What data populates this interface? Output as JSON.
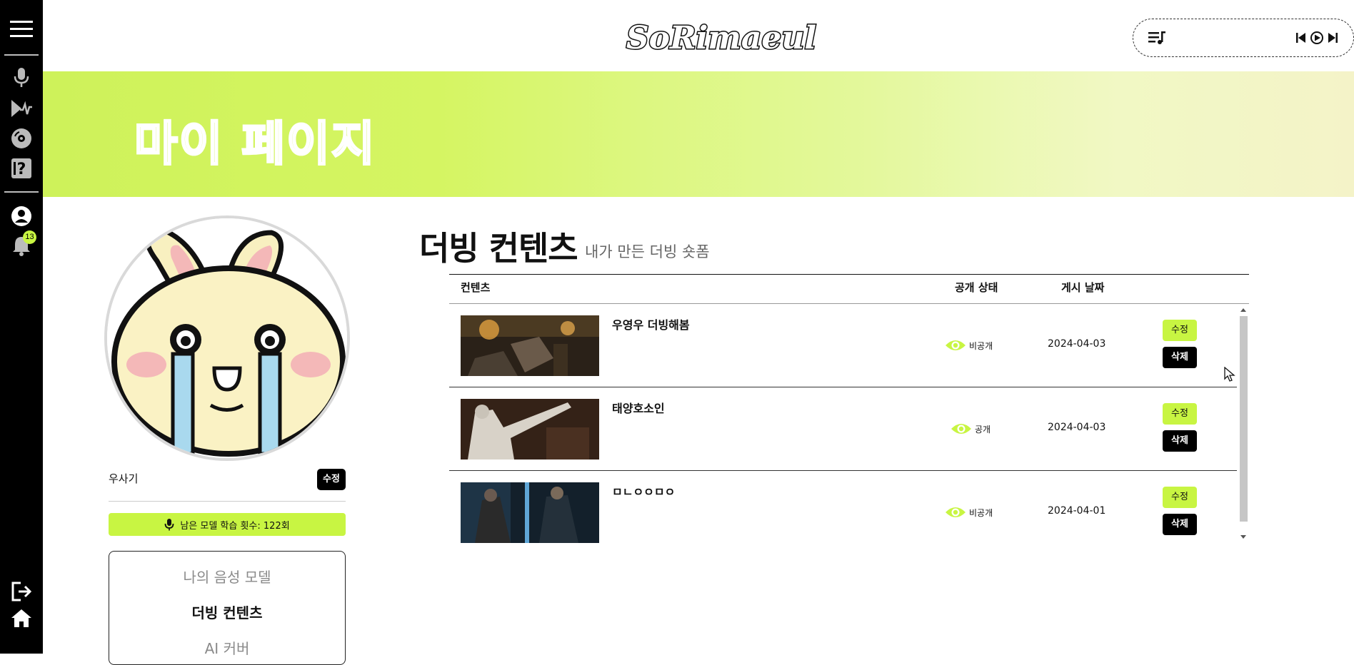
{
  "app": {
    "logo_text": "SoRimaeul"
  },
  "sidebar": {
    "icons": [
      "menu-icon",
      "microphone-icon",
      "voice-wave-icon",
      "disc-icon",
      "help-icon",
      "user-icon",
      "bell-icon",
      "logout-icon",
      "home-icon"
    ],
    "notification_count": "13"
  },
  "banner": {
    "title": "마이 페이지"
  },
  "profile": {
    "username": "우사기",
    "edit_label": "수정",
    "training_text": "남은 모델 학습 횟수: 122회",
    "menu": [
      "나의 음성 모델",
      "더빙 컨텐츠",
      "AI 커버"
    ]
  },
  "section": {
    "title": "더빙 컨텐츠",
    "subtitle": "내가 만든 더빙 숏폼"
  },
  "table": {
    "headers": {
      "content": "컨텐츠",
      "status": "공개 상태",
      "date": "게시 날짜"
    },
    "edit_label": "수정",
    "delete_label": "삭제",
    "rows": [
      {
        "title": "우영우 더빙해봄",
        "status": "비공개",
        "date": "2024-04-03"
      },
      {
        "title": "태양호소인",
        "status": "공개",
        "date": "2024-04-03"
      },
      {
        "title": "ㅁㄴㅇㅇㅁㅇ",
        "status": "비공개",
        "date": "2024-04-01"
      }
    ]
  },
  "colors": {
    "accent": "#c8f542",
    "sidebar": "#000000",
    "banner_start": "#cef25a",
    "banner_end": "#f4f3c8"
  }
}
